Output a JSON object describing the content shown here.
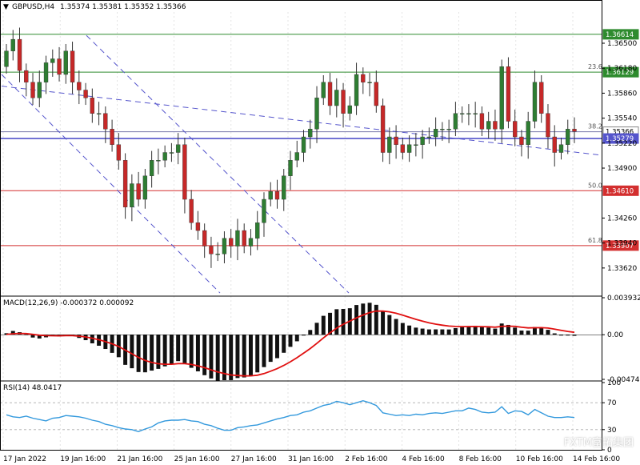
{
  "header": {
    "arrow": "▼",
    "symbol": "GBPUSD,H4",
    "ohlc": "1.35374 1.35381 1.35352 1.35366"
  },
  "colors": {
    "bull": "#2e7d32",
    "bear": "#c62828",
    "green_level": "#2e8b2e",
    "red_level": "#d32f2f",
    "blue_line": "#5555cc",
    "macd_signal": "#e01010",
    "rsi_line": "#3399dd",
    "grid": "#d8d8d8"
  },
  "watermark": "FXTM富拓集团",
  "chart_data": [
    {
      "type": "candlestick",
      "title": "GBPUSD,H4",
      "ylim": [
        1.3328,
        1.369
      ],
      "yticks": [
        "1.36500",
        "1.36180",
        "1.35860",
        "1.35540",
        "1.35220",
        "1.34900",
        "1.34260",
        "1.33940",
        "1.33620"
      ],
      "xticks": [
        "17 Jan 2022",
        "19 Jan 16:00",
        "21 Jan 16:00",
        "25 Jan 16:00",
        "27 Jan 16:00",
        "31 Jan 16:00",
        "2 Feb 16:00",
        "4 Feb 16:00",
        "8 Feb 16:00",
        "10 Feb 16:00",
        "14 Feb 16:00"
      ],
      "levels": [
        {
          "price": 1.36614,
          "label": "1.36614",
          "color": "green",
          "fib": ""
        },
        {
          "price": 1.36129,
          "label": "1.36129",
          "color": "green",
          "fib": "23.6"
        },
        {
          "price": 1.35366,
          "label": "1.35366",
          "color": "grey",
          "fib": "38.2"
        },
        {
          "price": 1.35279,
          "label": "1.35279",
          "color": "blue",
          "fib": ""
        },
        {
          "price": 1.3461,
          "label": "1.34610",
          "color": "red",
          "fib": "50.0"
        },
        {
          "price": 1.33907,
          "label": "1.33907",
          "color": "red",
          "fib": "61.8"
        }
      ],
      "closes": [
        1.364,
        1.3655,
        1.3615,
        1.36,
        1.358,
        1.36,
        1.3625,
        1.363,
        1.361,
        1.364,
        1.36,
        1.359,
        1.358,
        1.356,
        1.356,
        1.354,
        1.352,
        1.35,
        1.344,
        1.347,
        1.345,
        1.348,
        1.35,
        1.35,
        1.351,
        1.351,
        1.352,
        1.345,
        1.342,
        1.341,
        1.339,
        1.338,
        1.338,
        1.34,
        1.339,
        1.341,
        1.339,
        1.34,
        1.342,
        1.345,
        1.346,
        1.345,
        1.348,
        1.35,
        1.351,
        1.353,
        1.354,
        1.358,
        1.36,
        1.357,
        1.359,
        1.356,
        1.357,
        1.361,
        1.36,
        1.36,
        1.357,
        1.351,
        1.353,
        1.352,
        1.351,
        1.352,
        1.352,
        1.353,
        1.353,
        1.354,
        1.354,
        1.354,
        1.356,
        1.356,
        1.356,
        1.356,
        1.354,
        1.355,
        1.354,
        1.362,
        1.355,
        1.353,
        1.352,
        1.355,
        1.36,
        1.356,
        1.353,
        1.351,
        1.352,
        1.354,
        1.3537
      ],
      "open_first": 1.362
    },
    {
      "type": "bar",
      "title": "MACD(12,26,9) -0.000372 0.000092",
      "ylim": [
        -0.004742,
        0.003932
      ],
      "yticks": [
        "0.003932",
        "0.00",
        "-0.004742"
      ],
      "signal_series_name": "signal"
    },
    {
      "type": "line",
      "title": "RSI(14) 48.0417",
      "ylim": [
        0,
        100
      ],
      "yticks": [
        "100",
        "70",
        "30",
        "0"
      ],
      "values": [
        52,
        49,
        48,
        50,
        47,
        45,
        43,
        47,
        48,
        51,
        50,
        49,
        47,
        44,
        42,
        38,
        36,
        33,
        31,
        30,
        27,
        31,
        34,
        40,
        43,
        44,
        44,
        45,
        43,
        42,
        38,
        36,
        32,
        29,
        29,
        33,
        34,
        36,
        37,
        40,
        43,
        46,
        48,
        51,
        52,
        56,
        58,
        62,
        66,
        68,
        72,
        70,
        67,
        70,
        73,
        70,
        66,
        55,
        53,
        51,
        52,
        51,
        53,
        52,
        54,
        55,
        54,
        56,
        58,
        58,
        62,
        60,
        56,
        55,
        56,
        64,
        54,
        58,
        57,
        52,
        60,
        55,
        50,
        48,
        48,
        49,
        48
      ]
    }
  ]
}
